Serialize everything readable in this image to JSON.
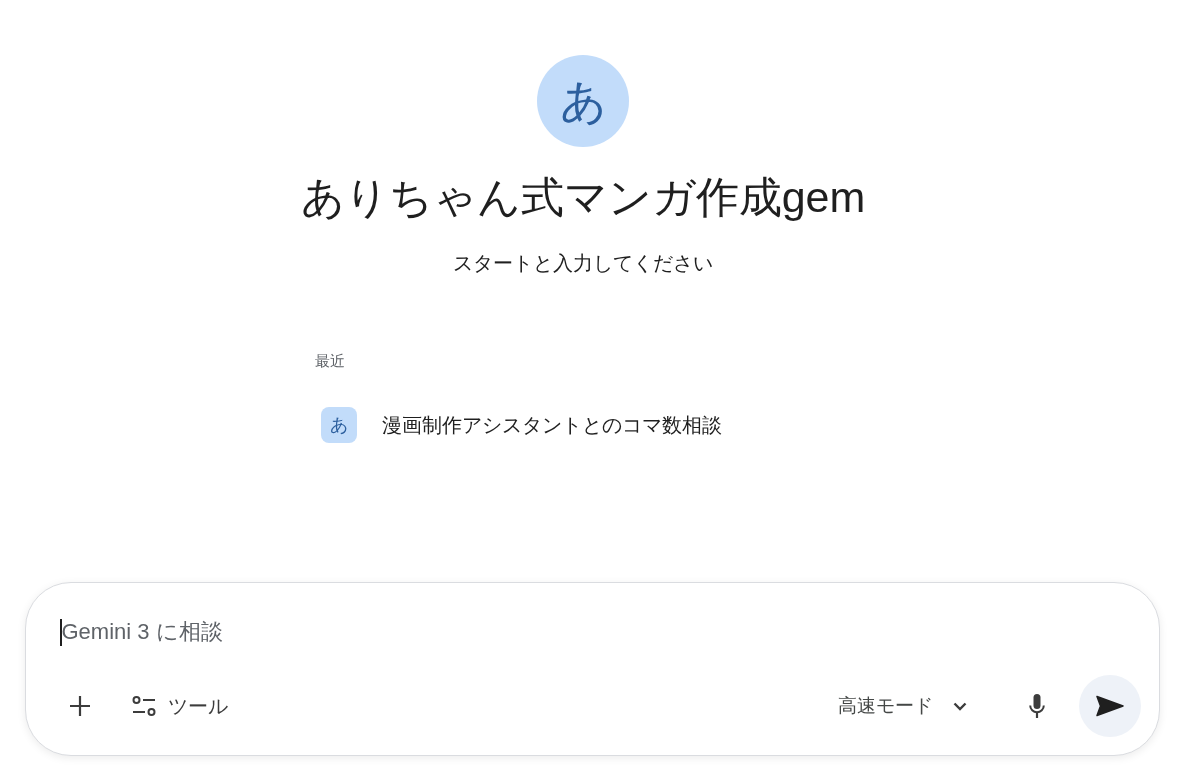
{
  "gem": {
    "avatar": "あ",
    "title": "ありちゃん式マンガ作成gem",
    "subtitle": "スタートと入力してください"
  },
  "recent": {
    "heading": "最近",
    "items": [
      {
        "avatar": "あ",
        "title": "漫画制作アシスタントとのコマ数相談"
      }
    ]
  },
  "composer": {
    "focused": true,
    "placeholder": "Gemini 3 に相談",
    "tools_label": "ツール",
    "mode": "高速モード"
  }
}
